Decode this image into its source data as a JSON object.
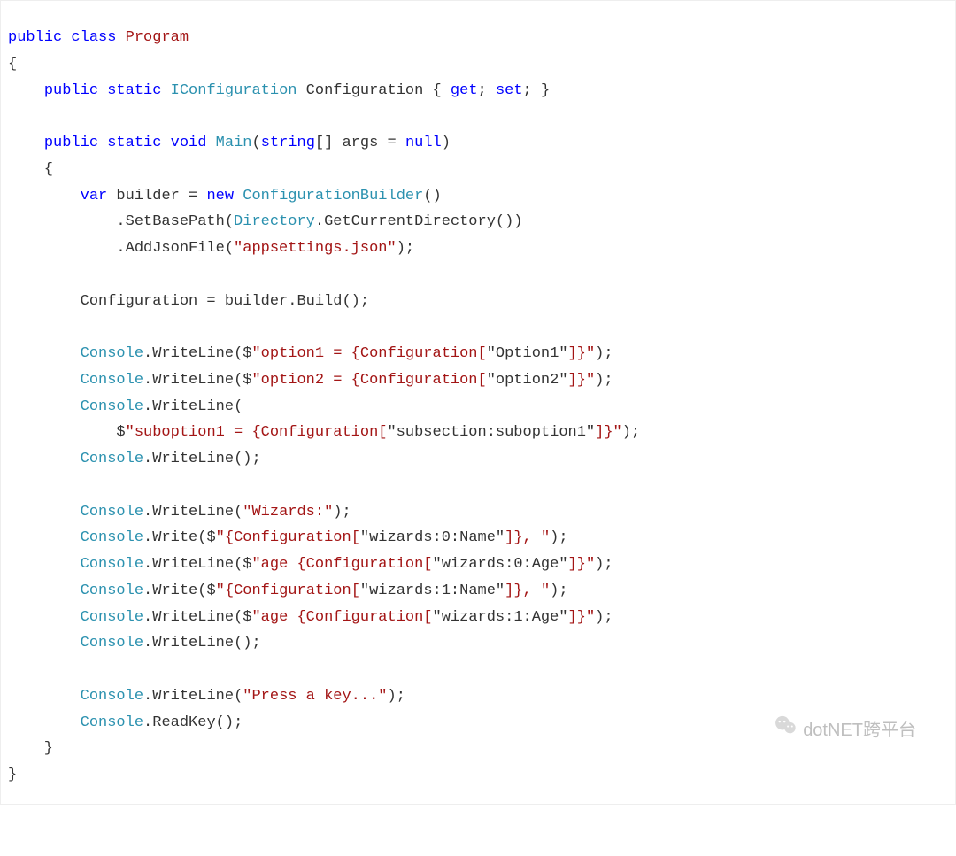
{
  "watermark": {
    "text": "dotNET跨平台",
    "icon": "wechat-icon"
  },
  "code": {
    "tokens": [
      [
        [
          "kw",
          "public"
        ],
        [
          "pun",
          " "
        ],
        [
          "kw",
          "class"
        ],
        [
          "pun",
          " "
        ],
        [
          "cls",
          "Program"
        ]
      ],
      [
        [
          "pun",
          "{"
        ]
      ],
      [
        [
          "pun",
          "    "
        ],
        [
          "kw",
          "public"
        ],
        [
          "pun",
          " "
        ],
        [
          "kw",
          "static"
        ],
        [
          "pun",
          " "
        ],
        [
          "tp",
          "IConfiguration"
        ],
        [
          "pun",
          " Configuration { "
        ],
        [
          "kw",
          "get"
        ],
        [
          "pun",
          "; "
        ],
        [
          "kw",
          "set"
        ],
        [
          "pun",
          "; }"
        ]
      ],
      [
        [
          "pun",
          ""
        ]
      ],
      [
        [
          "pun",
          "    "
        ],
        [
          "kw",
          "public"
        ],
        [
          "pun",
          " "
        ],
        [
          "kw",
          "static"
        ],
        [
          "pun",
          " "
        ],
        [
          "kw",
          "void"
        ],
        [
          "pun",
          " "
        ],
        [
          "tp",
          "Main"
        ],
        [
          "pun",
          "("
        ],
        [
          "kw",
          "string"
        ],
        [
          "pun",
          "[] args = "
        ],
        [
          "kw",
          "null"
        ],
        [
          "pun",
          ")"
        ]
      ],
      [
        [
          "pun",
          "    {"
        ]
      ],
      [
        [
          "pun",
          "        "
        ],
        [
          "kw",
          "var"
        ],
        [
          "pun",
          " builder = "
        ],
        [
          "kw",
          "new"
        ],
        [
          "pun",
          " "
        ],
        [
          "tp",
          "ConfigurationBuilder"
        ],
        [
          "pun",
          "()"
        ]
      ],
      [
        [
          "pun",
          "            .SetBasePath("
        ],
        [
          "tp",
          "Directory"
        ],
        [
          "pun",
          ".GetCurrentDirectory())"
        ]
      ],
      [
        [
          "pun",
          "            .AddJsonFile("
        ],
        [
          "str",
          "\"appsettings.json\""
        ],
        [
          "pun",
          ");"
        ]
      ],
      [
        [
          "pun",
          ""
        ]
      ],
      [
        [
          "pun",
          "        Configuration = builder.Build();"
        ]
      ],
      [
        [
          "pun",
          ""
        ]
      ],
      [
        [
          "pun",
          "        "
        ],
        [
          "tp",
          "Console"
        ],
        [
          "pun",
          ".WriteLine($"
        ],
        [
          "str",
          "\"option1 = {Configuration["
        ],
        [
          "pun",
          "\"Option1\""
        ],
        [
          "str",
          "]}\""
        ],
        [
          "pun",
          ");"
        ]
      ],
      [
        [
          "pun",
          "        "
        ],
        [
          "tp",
          "Console"
        ],
        [
          "pun",
          ".WriteLine($"
        ],
        [
          "str",
          "\"option2 = {Configuration["
        ],
        [
          "pun",
          "\"option2\""
        ],
        [
          "str",
          "]}\""
        ],
        [
          "pun",
          ");"
        ]
      ],
      [
        [
          "pun",
          "        "
        ],
        [
          "tp",
          "Console"
        ],
        [
          "pun",
          ".WriteLine("
        ]
      ],
      [
        [
          "pun",
          "            $"
        ],
        [
          "str",
          "\"suboption1 = {Configuration["
        ],
        [
          "pun",
          "\"subsection:suboption1\""
        ],
        [
          "str",
          "]}\""
        ],
        [
          "pun",
          ");"
        ]
      ],
      [
        [
          "pun",
          "        "
        ],
        [
          "tp",
          "Console"
        ],
        [
          "pun",
          ".WriteLine();"
        ]
      ],
      [
        [
          "pun",
          ""
        ]
      ],
      [
        [
          "pun",
          "        "
        ],
        [
          "tp",
          "Console"
        ],
        [
          "pun",
          ".WriteLine("
        ],
        [
          "str",
          "\"Wizards:\""
        ],
        [
          "pun",
          ");"
        ]
      ],
      [
        [
          "pun",
          "        "
        ],
        [
          "tp",
          "Console"
        ],
        [
          "pun",
          ".Write($"
        ],
        [
          "str",
          "\"{Configuration["
        ],
        [
          "pun",
          "\"wizards:0:Name\""
        ],
        [
          "str",
          "]}, \""
        ],
        [
          "pun",
          ");"
        ]
      ],
      [
        [
          "pun",
          "        "
        ],
        [
          "tp",
          "Console"
        ],
        [
          "pun",
          ".WriteLine($"
        ],
        [
          "str",
          "\"age {Configuration["
        ],
        [
          "pun",
          "\"wizards:0:Age\""
        ],
        [
          "str",
          "]}\""
        ],
        [
          "pun",
          ");"
        ]
      ],
      [
        [
          "pun",
          "        "
        ],
        [
          "tp",
          "Console"
        ],
        [
          "pun",
          ".Write($"
        ],
        [
          "str",
          "\"{Configuration["
        ],
        [
          "pun",
          "\"wizards:1:Name\""
        ],
        [
          "str",
          "]}, \""
        ],
        [
          "pun",
          ");"
        ]
      ],
      [
        [
          "pun",
          "        "
        ],
        [
          "tp",
          "Console"
        ],
        [
          "pun",
          ".WriteLine($"
        ],
        [
          "str",
          "\"age {Configuration["
        ],
        [
          "pun",
          "\"wizards:1:Age\""
        ],
        [
          "str",
          "]}\""
        ],
        [
          "pun",
          ");"
        ]
      ],
      [
        [
          "pun",
          "        "
        ],
        [
          "tp",
          "Console"
        ],
        [
          "pun",
          ".WriteLine();"
        ]
      ],
      [
        [
          "pun",
          ""
        ]
      ],
      [
        [
          "pun",
          "        "
        ],
        [
          "tp",
          "Console"
        ],
        [
          "pun",
          ".WriteLine("
        ],
        [
          "str",
          "\"Press a key...\""
        ],
        [
          "pun",
          ");"
        ]
      ],
      [
        [
          "pun",
          "        "
        ],
        [
          "tp",
          "Console"
        ],
        [
          "pun",
          ".ReadKey();"
        ]
      ],
      [
        [
          "pun",
          "    }"
        ]
      ],
      [
        [
          "pun",
          "}"
        ]
      ]
    ]
  }
}
